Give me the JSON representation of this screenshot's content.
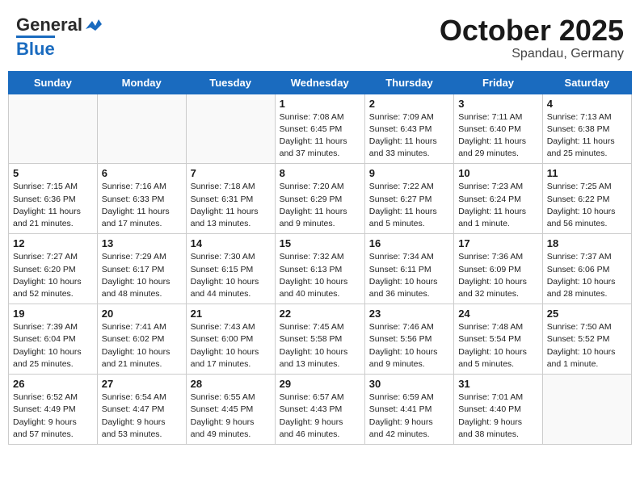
{
  "header": {
    "logo_general": "General",
    "logo_blue": "Blue",
    "month": "October 2025",
    "location": "Spandau, Germany"
  },
  "days_of_week": [
    "Sunday",
    "Monday",
    "Tuesday",
    "Wednesday",
    "Thursday",
    "Friday",
    "Saturday"
  ],
  "weeks": [
    [
      {
        "num": "",
        "info": ""
      },
      {
        "num": "",
        "info": ""
      },
      {
        "num": "",
        "info": ""
      },
      {
        "num": "1",
        "info": "Sunrise: 7:08 AM\nSunset: 6:45 PM\nDaylight: 11 hours\nand 37 minutes."
      },
      {
        "num": "2",
        "info": "Sunrise: 7:09 AM\nSunset: 6:43 PM\nDaylight: 11 hours\nand 33 minutes."
      },
      {
        "num": "3",
        "info": "Sunrise: 7:11 AM\nSunset: 6:40 PM\nDaylight: 11 hours\nand 29 minutes."
      },
      {
        "num": "4",
        "info": "Sunrise: 7:13 AM\nSunset: 6:38 PM\nDaylight: 11 hours\nand 25 minutes."
      }
    ],
    [
      {
        "num": "5",
        "info": "Sunrise: 7:15 AM\nSunset: 6:36 PM\nDaylight: 11 hours\nand 21 minutes."
      },
      {
        "num": "6",
        "info": "Sunrise: 7:16 AM\nSunset: 6:33 PM\nDaylight: 11 hours\nand 17 minutes."
      },
      {
        "num": "7",
        "info": "Sunrise: 7:18 AM\nSunset: 6:31 PM\nDaylight: 11 hours\nand 13 minutes."
      },
      {
        "num": "8",
        "info": "Sunrise: 7:20 AM\nSunset: 6:29 PM\nDaylight: 11 hours\nand 9 minutes."
      },
      {
        "num": "9",
        "info": "Sunrise: 7:22 AM\nSunset: 6:27 PM\nDaylight: 11 hours\nand 5 minutes."
      },
      {
        "num": "10",
        "info": "Sunrise: 7:23 AM\nSunset: 6:24 PM\nDaylight: 11 hours\nand 1 minute."
      },
      {
        "num": "11",
        "info": "Sunrise: 7:25 AM\nSunset: 6:22 PM\nDaylight: 10 hours\nand 56 minutes."
      }
    ],
    [
      {
        "num": "12",
        "info": "Sunrise: 7:27 AM\nSunset: 6:20 PM\nDaylight: 10 hours\nand 52 minutes."
      },
      {
        "num": "13",
        "info": "Sunrise: 7:29 AM\nSunset: 6:17 PM\nDaylight: 10 hours\nand 48 minutes."
      },
      {
        "num": "14",
        "info": "Sunrise: 7:30 AM\nSunset: 6:15 PM\nDaylight: 10 hours\nand 44 minutes."
      },
      {
        "num": "15",
        "info": "Sunrise: 7:32 AM\nSunset: 6:13 PM\nDaylight: 10 hours\nand 40 minutes."
      },
      {
        "num": "16",
        "info": "Sunrise: 7:34 AM\nSunset: 6:11 PM\nDaylight: 10 hours\nand 36 minutes."
      },
      {
        "num": "17",
        "info": "Sunrise: 7:36 AM\nSunset: 6:09 PM\nDaylight: 10 hours\nand 32 minutes."
      },
      {
        "num": "18",
        "info": "Sunrise: 7:37 AM\nSunset: 6:06 PM\nDaylight: 10 hours\nand 28 minutes."
      }
    ],
    [
      {
        "num": "19",
        "info": "Sunrise: 7:39 AM\nSunset: 6:04 PM\nDaylight: 10 hours\nand 25 minutes."
      },
      {
        "num": "20",
        "info": "Sunrise: 7:41 AM\nSunset: 6:02 PM\nDaylight: 10 hours\nand 21 minutes."
      },
      {
        "num": "21",
        "info": "Sunrise: 7:43 AM\nSunset: 6:00 PM\nDaylight: 10 hours\nand 17 minutes."
      },
      {
        "num": "22",
        "info": "Sunrise: 7:45 AM\nSunset: 5:58 PM\nDaylight: 10 hours\nand 13 minutes."
      },
      {
        "num": "23",
        "info": "Sunrise: 7:46 AM\nSunset: 5:56 PM\nDaylight: 10 hours\nand 9 minutes."
      },
      {
        "num": "24",
        "info": "Sunrise: 7:48 AM\nSunset: 5:54 PM\nDaylight: 10 hours\nand 5 minutes."
      },
      {
        "num": "25",
        "info": "Sunrise: 7:50 AM\nSunset: 5:52 PM\nDaylight: 10 hours\nand 1 minute."
      }
    ],
    [
      {
        "num": "26",
        "info": "Sunrise: 6:52 AM\nSunset: 4:49 PM\nDaylight: 9 hours\nand 57 minutes."
      },
      {
        "num": "27",
        "info": "Sunrise: 6:54 AM\nSunset: 4:47 PM\nDaylight: 9 hours\nand 53 minutes."
      },
      {
        "num": "28",
        "info": "Sunrise: 6:55 AM\nSunset: 4:45 PM\nDaylight: 9 hours\nand 49 minutes."
      },
      {
        "num": "29",
        "info": "Sunrise: 6:57 AM\nSunset: 4:43 PM\nDaylight: 9 hours\nand 46 minutes."
      },
      {
        "num": "30",
        "info": "Sunrise: 6:59 AM\nSunset: 4:41 PM\nDaylight: 9 hours\nand 42 minutes."
      },
      {
        "num": "31",
        "info": "Sunrise: 7:01 AM\nSunset: 4:40 PM\nDaylight: 9 hours\nand 38 minutes."
      },
      {
        "num": "",
        "info": ""
      }
    ]
  ]
}
